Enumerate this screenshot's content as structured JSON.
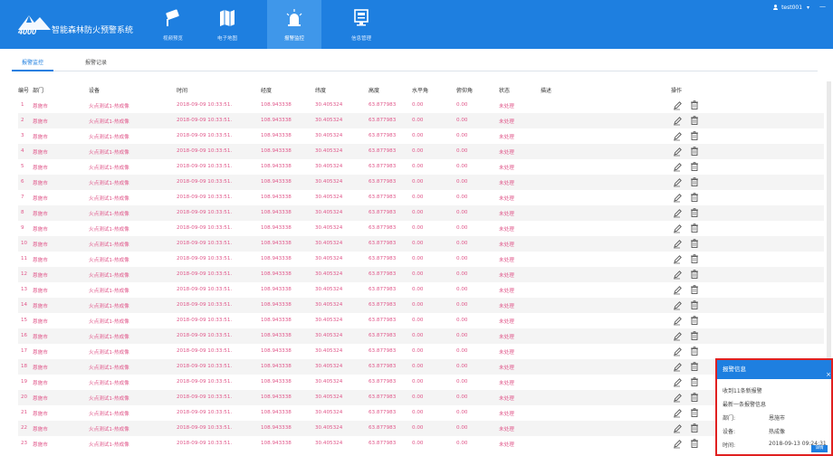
{
  "app": {
    "logo_text": "4000",
    "title": "智能森林防火预警系统"
  },
  "nav": [
    {
      "label": "视频预览",
      "icon": "cctv-camera-icon"
    },
    {
      "label": "电子地图",
      "icon": "map-icon"
    },
    {
      "label": "报警监控",
      "icon": "alarm-light-icon"
    },
    {
      "label": "信息管理",
      "icon": "info-monitor-icon"
    }
  ],
  "user": {
    "name": "test001",
    "caret": "▾",
    "window_min": "—"
  },
  "tabs": [
    {
      "label": "报警监控"
    },
    {
      "label": "报警记录"
    }
  ],
  "table": {
    "headers": [
      "编号",
      "部门",
      "设备",
      "时间",
      "经度",
      "纬度",
      "高度",
      "水平角",
      "俯仰角",
      "状态",
      "描述",
      "操作"
    ],
    "rows": [
      {
        "id": "1",
        "dept": "恩施市",
        "device": "火点测试1-热成像",
        "time": "2018-09-09 10:33:51.",
        "lng": "108.943338",
        "lat": "30.405324",
        "alt": "63.877983",
        "h_angle": "0.00",
        "v_angle": "0.00",
        "status": "未处理",
        "desc": ""
      },
      {
        "id": "2",
        "dept": "恩施市",
        "device": "火点测试1-热成像",
        "time": "2018-09-09 10:33:51.",
        "lng": "108.943338",
        "lat": "30.405324",
        "alt": "63.877983",
        "h_angle": "0.00",
        "v_angle": "0.00",
        "status": "未处理",
        "desc": ""
      },
      {
        "id": "3",
        "dept": "恩施市",
        "device": "火点测试1-热成像",
        "time": "2018-09-09 10:33:51.",
        "lng": "108.943338",
        "lat": "30.405324",
        "alt": "63.877983",
        "h_angle": "0.00",
        "v_angle": "0.00",
        "status": "未处理",
        "desc": ""
      },
      {
        "id": "4",
        "dept": "恩施市",
        "device": "火点测试1-热成像",
        "time": "2018-09-09 10:33:51.",
        "lng": "108.943338",
        "lat": "30.405324",
        "alt": "63.877983",
        "h_angle": "0.00",
        "v_angle": "0.00",
        "status": "未处理",
        "desc": ""
      },
      {
        "id": "5",
        "dept": "恩施市",
        "device": "火点测试1-热成像",
        "time": "2018-09-09 10:33:51.",
        "lng": "108.943338",
        "lat": "30.405324",
        "alt": "63.877983",
        "h_angle": "0.00",
        "v_angle": "0.00",
        "status": "未处理",
        "desc": ""
      },
      {
        "id": "6",
        "dept": "恩施市",
        "device": "火点测试1-热成像",
        "time": "2018-09-09 10:33:51.",
        "lng": "108.943338",
        "lat": "30.405324",
        "alt": "63.877983",
        "h_angle": "0.00",
        "v_angle": "0.00",
        "status": "未处理",
        "desc": ""
      },
      {
        "id": "7",
        "dept": "恩施市",
        "device": "火点测试1-热成像",
        "time": "2018-09-09 10:33:51.",
        "lng": "108.943338",
        "lat": "30.405324",
        "alt": "63.877983",
        "h_angle": "0.00",
        "v_angle": "0.00",
        "status": "未处理",
        "desc": ""
      },
      {
        "id": "8",
        "dept": "恩施市",
        "device": "火点测试1-热成像",
        "time": "2018-09-09 10:33:51.",
        "lng": "108.943338",
        "lat": "30.405324",
        "alt": "63.877983",
        "h_angle": "0.00",
        "v_angle": "0.00",
        "status": "未处理",
        "desc": ""
      },
      {
        "id": "9",
        "dept": "恩施市",
        "device": "火点测试1-热成像",
        "time": "2018-09-09 10:33:51.",
        "lng": "108.943338",
        "lat": "30.405324",
        "alt": "63.877983",
        "h_angle": "0.00",
        "v_angle": "0.00",
        "status": "未处理",
        "desc": ""
      },
      {
        "id": "10",
        "dept": "恩施市",
        "device": "火点测试1-热成像",
        "time": "2018-09-09 10:33:51.",
        "lng": "108.943338",
        "lat": "30.405324",
        "alt": "63.877983",
        "h_angle": "0.00",
        "v_angle": "0.00",
        "status": "未处理",
        "desc": ""
      },
      {
        "id": "11",
        "dept": "恩施市",
        "device": "火点测试1-热成像",
        "time": "2018-09-09 10:33:51.",
        "lng": "108.943338",
        "lat": "30.405324",
        "alt": "63.877983",
        "h_angle": "0.00",
        "v_angle": "0.00",
        "status": "未处理",
        "desc": ""
      },
      {
        "id": "12",
        "dept": "恩施市",
        "device": "火点测试1-热成像",
        "time": "2018-09-09 10:33:51.",
        "lng": "108.943338",
        "lat": "30.405324",
        "alt": "63.877983",
        "h_angle": "0.00",
        "v_angle": "0.00",
        "status": "未处理",
        "desc": ""
      },
      {
        "id": "13",
        "dept": "恩施市",
        "device": "火点测试1-热成像",
        "time": "2018-09-09 10:33:51.",
        "lng": "108.943338",
        "lat": "30.405324",
        "alt": "63.877983",
        "h_angle": "0.00",
        "v_angle": "0.00",
        "status": "未处理",
        "desc": ""
      },
      {
        "id": "14",
        "dept": "恩施市",
        "device": "火点测试1-热成像",
        "time": "2018-09-09 10:33:51.",
        "lng": "108.943338",
        "lat": "30.405324",
        "alt": "63.877983",
        "h_angle": "0.00",
        "v_angle": "0.00",
        "status": "未处理",
        "desc": ""
      },
      {
        "id": "15",
        "dept": "恩施市",
        "device": "火点测试1-热成像",
        "time": "2018-09-09 10:33:51.",
        "lng": "108.943338",
        "lat": "30.405324",
        "alt": "63.877983",
        "h_angle": "0.00",
        "v_angle": "0.00",
        "status": "未处理",
        "desc": ""
      },
      {
        "id": "16",
        "dept": "恩施市",
        "device": "火点测试1-热成像",
        "time": "2018-09-09 10:33:51.",
        "lng": "108.943338",
        "lat": "30.405324",
        "alt": "63.877983",
        "h_angle": "0.00",
        "v_angle": "0.00",
        "status": "未处理",
        "desc": ""
      },
      {
        "id": "17",
        "dept": "恩施市",
        "device": "火点测试1-热成像",
        "time": "2018-09-09 10:33:51.",
        "lng": "108.943338",
        "lat": "30.405324",
        "alt": "63.877983",
        "h_angle": "0.00",
        "v_angle": "0.00",
        "status": "未处理",
        "desc": ""
      },
      {
        "id": "18",
        "dept": "恩施市",
        "device": "火点测试1-热成像",
        "time": "2018-09-09 10:33:51.",
        "lng": "108.943338",
        "lat": "30.405324",
        "alt": "63.877983",
        "h_angle": "0.00",
        "v_angle": "0.00",
        "status": "未处理",
        "desc": ""
      },
      {
        "id": "19",
        "dept": "恩施市",
        "device": "火点测试1-热成像",
        "time": "2018-09-09 10:33:51.",
        "lng": "108.943338",
        "lat": "30.405324",
        "alt": "63.877983",
        "h_angle": "0.00",
        "v_angle": "0.00",
        "status": "未处理",
        "desc": ""
      },
      {
        "id": "20",
        "dept": "恩施市",
        "device": "火点测试1-热成像",
        "time": "2018-09-09 10:33:51.",
        "lng": "108.943338",
        "lat": "30.405324",
        "alt": "63.877983",
        "h_angle": "0.00",
        "v_angle": "0.00",
        "status": "未处理",
        "desc": ""
      },
      {
        "id": "21",
        "dept": "恩施市",
        "device": "火点测试1-热成像",
        "time": "2018-09-09 10:33:51.",
        "lng": "108.943338",
        "lat": "30.405324",
        "alt": "63.877983",
        "h_angle": "0.00",
        "v_angle": "0.00",
        "status": "未处理",
        "desc": ""
      },
      {
        "id": "22",
        "dept": "恩施市",
        "device": "火点测试1-热成像",
        "time": "2018-09-09 10:33:51.",
        "lng": "108.943338",
        "lat": "30.405324",
        "alt": "63.877983",
        "h_angle": "0.00",
        "v_angle": "0.00",
        "status": "未处理",
        "desc": ""
      },
      {
        "id": "23",
        "dept": "恩施市",
        "device": "火点测试1-热成像",
        "time": "2018-09-09 10:33:51.",
        "lng": "108.943338",
        "lat": "30.405324",
        "alt": "63.877983",
        "h_angle": "0.00",
        "v_angle": "0.00",
        "status": "未处理",
        "desc": ""
      }
    ],
    "actions": [
      {
        "icon": "edit-pencil-icon"
      },
      {
        "icon": "delete-trash-icon"
      }
    ]
  },
  "popup": {
    "title": "报警信息",
    "close": "×",
    "count_text": "收到11条新报警",
    "latest_text": "最新一条报警信息",
    "dept_label": "部门:",
    "dept_value": "恩施市",
    "device_label": "设备:",
    "device_value": "热成像",
    "time_label": "时间:",
    "time_value": "2018-09-13 09:24:31",
    "button_label": "详情"
  },
  "colors": {
    "header": "#1e7fe0",
    "alarm_text": "#e0578a",
    "popup_border": "#e02020"
  }
}
